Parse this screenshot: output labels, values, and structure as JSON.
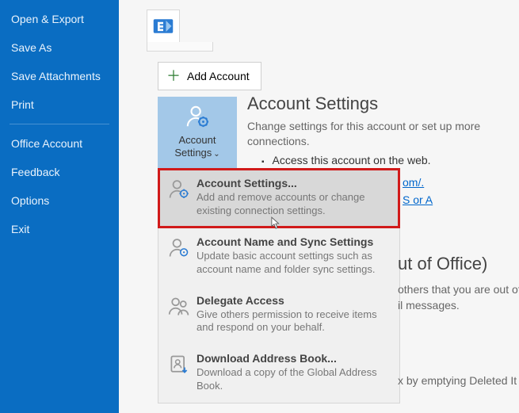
{
  "sidebar": {
    "items": [
      "Open & Export",
      "Save As",
      "Save Attachments",
      "Print",
      "Office Account",
      "Feedback",
      "Options",
      "Exit"
    ]
  },
  "add_account_label": "Add Account",
  "as_button": {
    "line1": "Account",
    "line2": "Settings"
  },
  "panel": {
    "title": "Account Settings",
    "sub": "Change settings for this account or set up more connections.",
    "bullet": "Access this account on the web."
  },
  "link_frag1": "om/.",
  "link_frag2": "S or A",
  "dropdown": [
    {
      "title": "Account Settings...",
      "desc": "Add and remove accounts or change existing connection settings."
    },
    {
      "title": "Account Name and Sync Settings",
      "desc": "Update basic account settings such as account name and folder sync settings."
    },
    {
      "title": "Delegate Access",
      "desc": "Give others permission to receive items and respond on your behalf."
    },
    {
      "title": "Download Address Book...",
      "desc": "Download a copy of the Global Address Book."
    }
  ],
  "bg": {
    "ooo_title": "ut of Office)",
    "ooo_desc": "others that you are out of il messages.",
    "mbx": "x by emptying Deleted It"
  }
}
